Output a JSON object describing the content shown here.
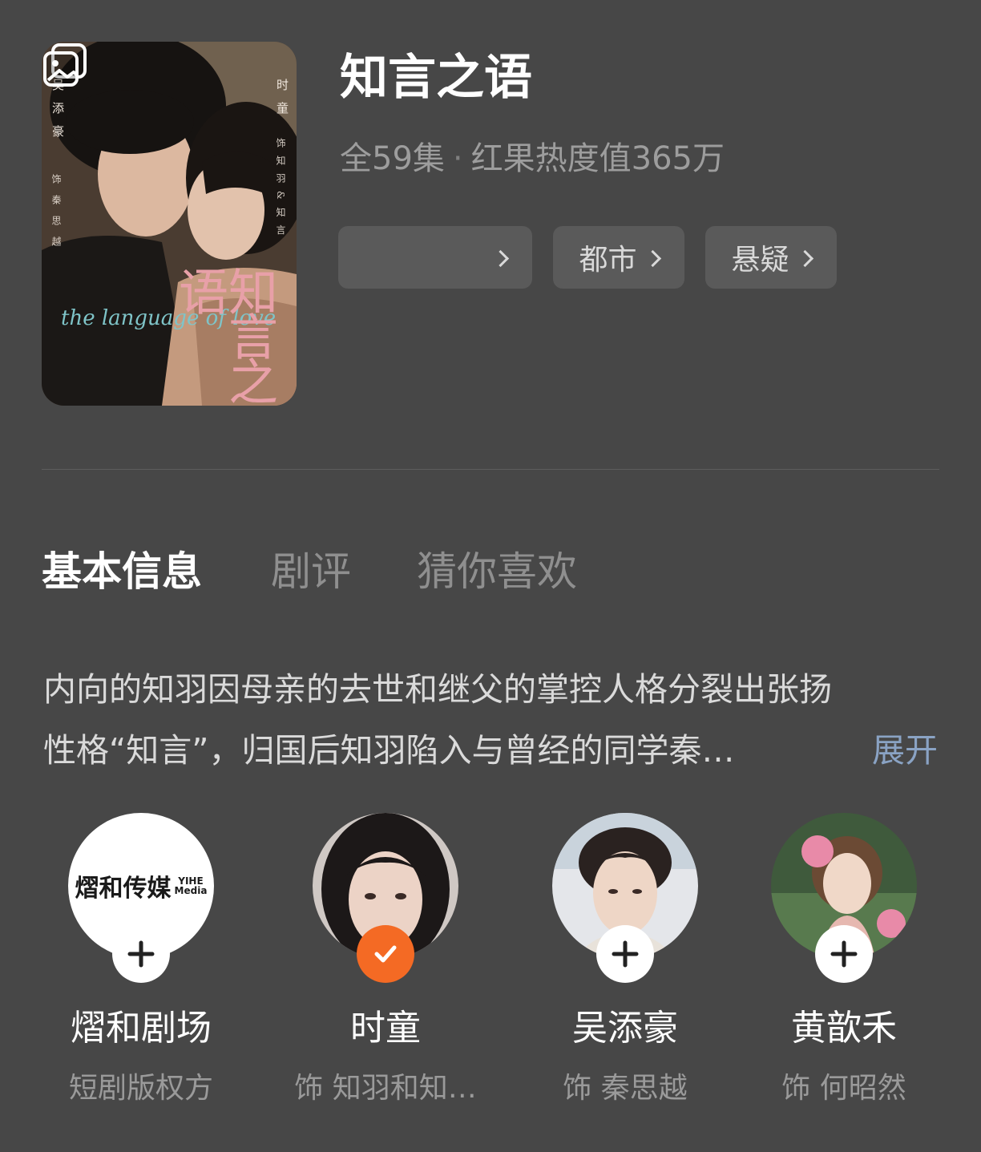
{
  "show": {
    "title": "知言之语",
    "episodes": "全59集",
    "separator": "·",
    "heat": "红果热度值365万"
  },
  "poster": {
    "actor_left": "吴添豪",
    "role_left": "饰秦思越",
    "actor_right": "时童",
    "role_right": "饰知羽&知言",
    "title_art": "知言之语",
    "english_title": "the language of love"
  },
  "tags": [
    {
      "label": ""
    },
    {
      "label": "都市"
    },
    {
      "label": "悬疑"
    }
  ],
  "tabs": [
    {
      "label": "基本信息"
    },
    {
      "label": "剧评"
    },
    {
      "label": "猜你喜欢"
    }
  ],
  "description": {
    "line1": "内向的知羽因母亲的去世和继父的掌控人格分裂出张扬",
    "line2": "性格“知言”，归国后知羽陷入与曾经的同学秦…",
    "expand_label": "展开"
  },
  "cast": [
    {
      "name": "熠和剧场",
      "role": "短剧版权方",
      "followed": false,
      "logo_text": "熠和传媒",
      "logo_sub1": "YIHE",
      "logo_sub2": "Media"
    },
    {
      "name": "时童",
      "role": "饰 知羽和知…",
      "followed": true
    },
    {
      "name": "吴添豪",
      "role": "饰 秦思越",
      "followed": false
    },
    {
      "name": "黄歆禾",
      "role": "饰 何昭然",
      "followed": false
    }
  ],
  "colors": {
    "background": "#474747",
    "follow_accent": "#f46a24",
    "expand_link": "#8aa3c4"
  }
}
